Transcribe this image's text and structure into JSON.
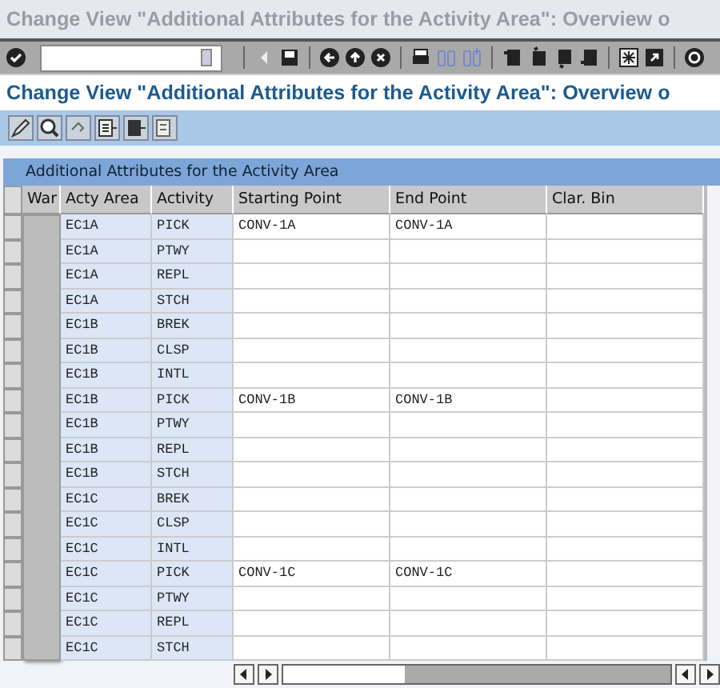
{
  "window": {
    "title": "Change View \"Additional Attributes for the Activity Area\": Overview o"
  },
  "screen_title": "Change View \"Additional Attributes for the Activity Area\": Overview o",
  "table": {
    "title": "Additional Attributes for the Activity Area",
    "columns": [
      "War",
      "Acty Area",
      "Activity",
      "Starting Point",
      "End Point",
      "Clar. Bin"
    ],
    "rows": [
      {
        "acty_area": "EC1A",
        "activity": "PICK",
        "starting_point": "CONV-1A",
        "end_point": "CONV-1A"
      },
      {
        "acty_area": "EC1A",
        "activity": "PTWY"
      },
      {
        "acty_area": "EC1A",
        "activity": "REPL"
      },
      {
        "acty_area": "EC1A",
        "activity": "STCH"
      },
      {
        "acty_area": "EC1B",
        "activity": "BREK"
      },
      {
        "acty_area": "EC1B",
        "activity": "CLSP"
      },
      {
        "acty_area": "EC1B",
        "activity": "INTL"
      },
      {
        "acty_area": "EC1B",
        "activity": "PICK",
        "starting_point": "CONV-1B",
        "end_point": "CONV-1B"
      },
      {
        "acty_area": "EC1B",
        "activity": "PTWY"
      },
      {
        "acty_area": "EC1B",
        "activity": "REPL"
      },
      {
        "acty_area": "EC1B",
        "activity": "STCH"
      },
      {
        "acty_area": "EC1C",
        "activity": "BREK"
      },
      {
        "acty_area": "EC1C",
        "activity": "CLSP"
      },
      {
        "acty_area": "EC1C",
        "activity": "INTL"
      },
      {
        "acty_area": "EC1C",
        "activity": "PICK",
        "starting_point": "CONV-1C",
        "end_point": "CONV-1C"
      },
      {
        "acty_area": "EC1C",
        "activity": "PTWY"
      },
      {
        "acty_area": "EC1C",
        "activity": "REPL"
      },
      {
        "acty_area": "EC1C",
        "activity": "STCH"
      }
    ]
  }
}
